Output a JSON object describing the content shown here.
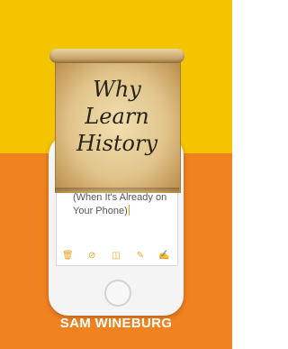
{
  "title_lines": [
    "Why",
    "Learn",
    "History"
  ],
  "subtitle": "(When It's Already on Your Phone)",
  "author": "SAM WINEBURG",
  "toolbar_icons": [
    "trash-icon",
    "checklist-icon",
    "camera-icon",
    "sketch-icon",
    "compose-icon"
  ],
  "colors": {
    "top_background": "#f5c400",
    "bottom_background": "#f08320",
    "cursor": "#e6a100",
    "author_text": "#ffffff"
  }
}
